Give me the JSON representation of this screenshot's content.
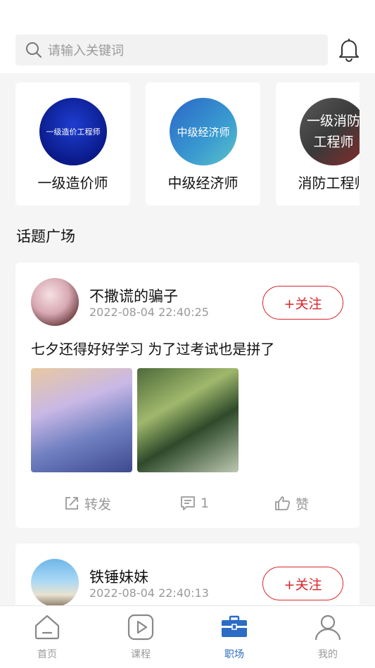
{
  "search": {
    "placeholder": "请输入关键词"
  },
  "categories": [
    {
      "label": "一级造价师",
      "image_text": "一级造价工程师"
    },
    {
      "label": "中级经济师",
      "image_text": "中级经济师"
    },
    {
      "label": "消防工程师",
      "image_text": "一级消防工程师"
    }
  ],
  "section_title": "话题广场",
  "posts": [
    {
      "username": "不撒谎的骗子",
      "time": "2022-08-04 22:40:25",
      "follow_label": "+关注",
      "content": "七夕还得好好学习 为了过考试也是拼了",
      "actions": {
        "share": "转发",
        "comment_count": "1",
        "like": "赞"
      }
    },
    {
      "username": "铁锤妹妹",
      "time": "2022-08-04 22:40:13",
      "follow_label": "+关注"
    }
  ],
  "tabs": [
    {
      "label": "首页",
      "icon": "home-icon"
    },
    {
      "label": "课程",
      "icon": "play-icon"
    },
    {
      "label": "职场",
      "icon": "briefcase-icon",
      "active": true
    },
    {
      "label": "我的",
      "icon": "person-icon"
    }
  ],
  "colors": {
    "accent_red": "#d9262c",
    "active_blue": "#2b6cc4",
    "muted": "#999999"
  }
}
